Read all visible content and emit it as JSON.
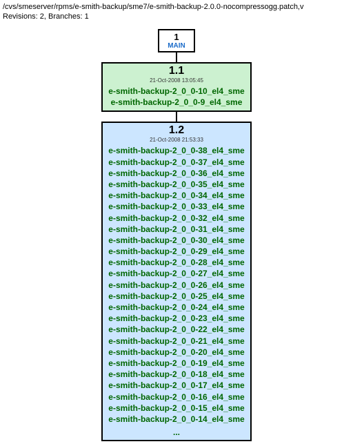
{
  "header": {
    "path": "/cvs/smeserver/rpms/e-smith-backup/sme7/e-smith-backup-2.0.0-nocompressogg.patch,v",
    "revisions_label": "Revisions: 2, Branches: 1"
  },
  "main_node": {
    "number": "1",
    "label": "MAIN"
  },
  "rev1": {
    "version": "1.1",
    "date": "21-Oct-2008 13:05:45",
    "items": [
      "e-smith-backup-2_0_0-10_el4_sme",
      "e-smith-backup-2_0_0-9_el4_sme"
    ]
  },
  "rev2": {
    "version": "1.2",
    "date": "21-Oct-2008 21:53:33",
    "items": [
      "e-smith-backup-2_0_0-38_el4_sme",
      "e-smith-backup-2_0_0-37_el4_sme",
      "e-smith-backup-2_0_0-36_el4_sme",
      "e-smith-backup-2_0_0-35_el4_sme",
      "e-smith-backup-2_0_0-34_el4_sme",
      "e-smith-backup-2_0_0-33_el4_sme",
      "e-smith-backup-2_0_0-32_el4_sme",
      "e-smith-backup-2_0_0-31_el4_sme",
      "e-smith-backup-2_0_0-30_el4_sme",
      "e-smith-backup-2_0_0-29_el4_sme",
      "e-smith-backup-2_0_0-28_el4_sme",
      "e-smith-backup-2_0_0-27_el4_sme",
      "e-smith-backup-2_0_0-26_el4_sme",
      "e-smith-backup-2_0_0-25_el4_sme",
      "e-smith-backup-2_0_0-24_el4_sme",
      "e-smith-backup-2_0_0-23_el4_sme",
      "e-smith-backup-2_0_0-22_el4_sme",
      "e-smith-backup-2_0_0-21_el4_sme",
      "e-smith-backup-2_0_0-20_el4_sme",
      "e-smith-backup-2_0_0-19_el4_sme",
      "e-smith-backup-2_0_0-18_el4_sme",
      "e-smith-backup-2_0_0-17_el4_sme",
      "e-smith-backup-2_0_0-16_el4_sme",
      "e-smith-backup-2_0_0-15_el4_sme",
      "e-smith-backup-2_0_0-14_el4_sme"
    ],
    "ellipsis": "..."
  }
}
